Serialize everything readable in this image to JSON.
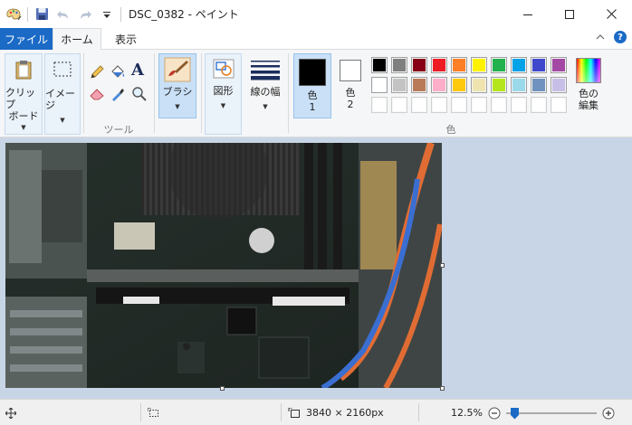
{
  "window": {
    "title": "DSC_0382 - ペイント",
    "minimize_icon": "minimize-icon",
    "maximize_icon": "maximize-icon",
    "close_icon": "close-icon"
  },
  "tabs": {
    "file": "ファイル",
    "home": "ホーム",
    "view": "表示"
  },
  "ribbon": {
    "clipboard_label": "クリップ\nボード",
    "clipboard_line1": "クリップ",
    "clipboard_line2": "ボード",
    "image_label": "イメージ",
    "tools_group": "ツール",
    "brush_label": "ブラシ",
    "shapes_label": "図形",
    "line_width_label": "線の幅",
    "color1_line1": "色",
    "color1_line2": "1",
    "color2_line1": "色",
    "color2_line2": "2",
    "colors_group": "色",
    "edit_colors_line1": "色の",
    "edit_colors_line2": "編集"
  },
  "palette": {
    "color1": "#000000",
    "color2": "#ffffff",
    "row1": [
      "#000000",
      "#7f7f7f",
      "#880015",
      "#ed1c24",
      "#ff7f27",
      "#fff200",
      "#22b14c",
      "#00a2e8",
      "#3f48cc",
      "#a349a4"
    ],
    "row2": [
      "#ffffff",
      "#c3c3c3",
      "#b97a57",
      "#ffaec9",
      "#ffc90e",
      "#efe4b0",
      "#b5e61d",
      "#99d9ea",
      "#7092be",
      "#c8bfe7"
    ],
    "row3": [
      "#ffffff",
      "#ffffff",
      "#ffffff",
      "#ffffff",
      "#ffffff",
      "#ffffff",
      "#ffffff",
      "#ffffff",
      "#ffffff",
      "#ffffff"
    ]
  },
  "status": {
    "image_size": "3840 × 2160px",
    "zoom": "12.5%",
    "zoom_level": 0.125
  }
}
